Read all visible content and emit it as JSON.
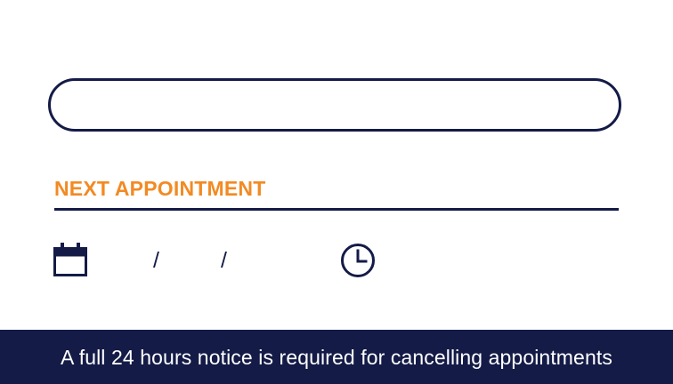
{
  "name_field": {
    "value": ""
  },
  "next_appointment": {
    "title": "NEXT APPOINTMENT",
    "date_separator_1": "/",
    "date_separator_2": "/",
    "date_icon": "calendar-icon",
    "time_icon": "clock-icon"
  },
  "footer": {
    "notice": "A full 24 hours notice is required for cancelling appointments"
  },
  "colors": {
    "navy": "#141b47",
    "orange": "#f28a23",
    "background": "#ffffff"
  }
}
